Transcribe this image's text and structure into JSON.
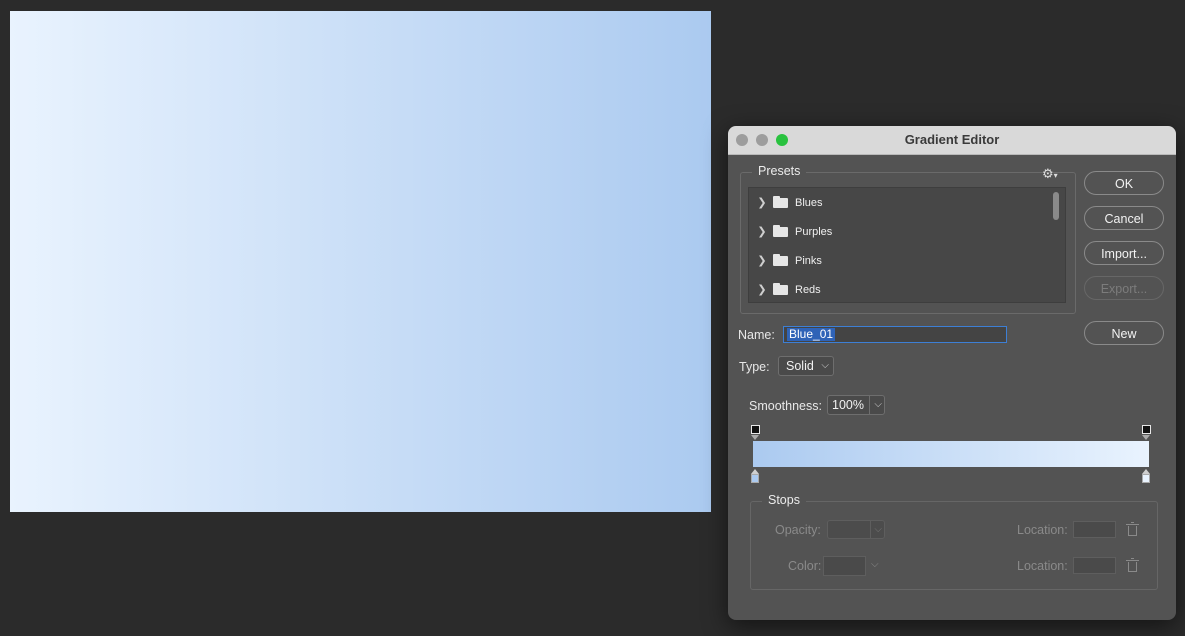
{
  "canvas": {
    "gradient_start": "#e9f3fe",
    "gradient_end": "#abcaf0"
  },
  "dialog": {
    "title": "Gradient Editor",
    "presets": {
      "legend": "Presets",
      "items": [
        {
          "label": "Blues"
        },
        {
          "label": "Purples"
        },
        {
          "label": "Pinks"
        },
        {
          "label": "Reds"
        }
      ]
    },
    "buttons": {
      "ok": "OK",
      "cancel": "Cancel",
      "import": "Import...",
      "export": "Export...",
      "new": "New"
    },
    "name": {
      "label": "Name:",
      "value": "Blue_01"
    },
    "type": {
      "label": "Type:",
      "value": "Solid"
    },
    "smoothness": {
      "label": "Smoothness:",
      "value": "100%"
    },
    "gradient": {
      "left_color": "#abcaf0",
      "right_color": "#e9f3fe"
    },
    "stops": {
      "legend": "Stops",
      "opacity_label": "Opacity:",
      "color_label": "Color:",
      "location_label": "Location:"
    }
  }
}
